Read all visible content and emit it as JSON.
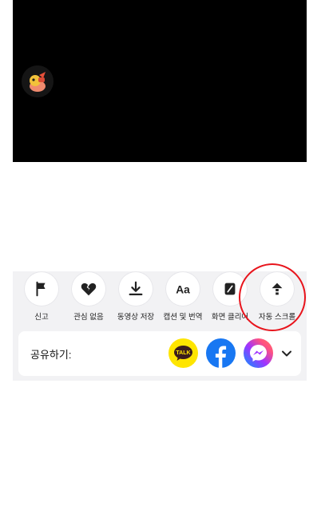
{
  "video": {
    "avatar_icon": "hamster-avatar-icon"
  },
  "actions": [
    {
      "label": "신고",
      "icon": "flag-icon"
    },
    {
      "label": "관심 없음",
      "icon": "broken-heart-icon"
    },
    {
      "label": "동영상 저장",
      "icon": "download-icon"
    },
    {
      "label": "캡션 및 번역",
      "icon": "text-aa-icon"
    },
    {
      "label": "화면 클리어",
      "icon": "clear-screen-icon"
    },
    {
      "label": "자동 스크롤",
      "icon": "auto-scroll-icon"
    }
  ],
  "share": {
    "label": "공유하기:",
    "kakao_text": "TALK",
    "targets": [
      "kakaotalk",
      "facebook",
      "messenger"
    ],
    "more_icon": "chevron-down-icon"
  },
  "colors": {
    "kakao": "#FEE500",
    "facebook": "#1877F2",
    "highlight": "#E8141C"
  }
}
